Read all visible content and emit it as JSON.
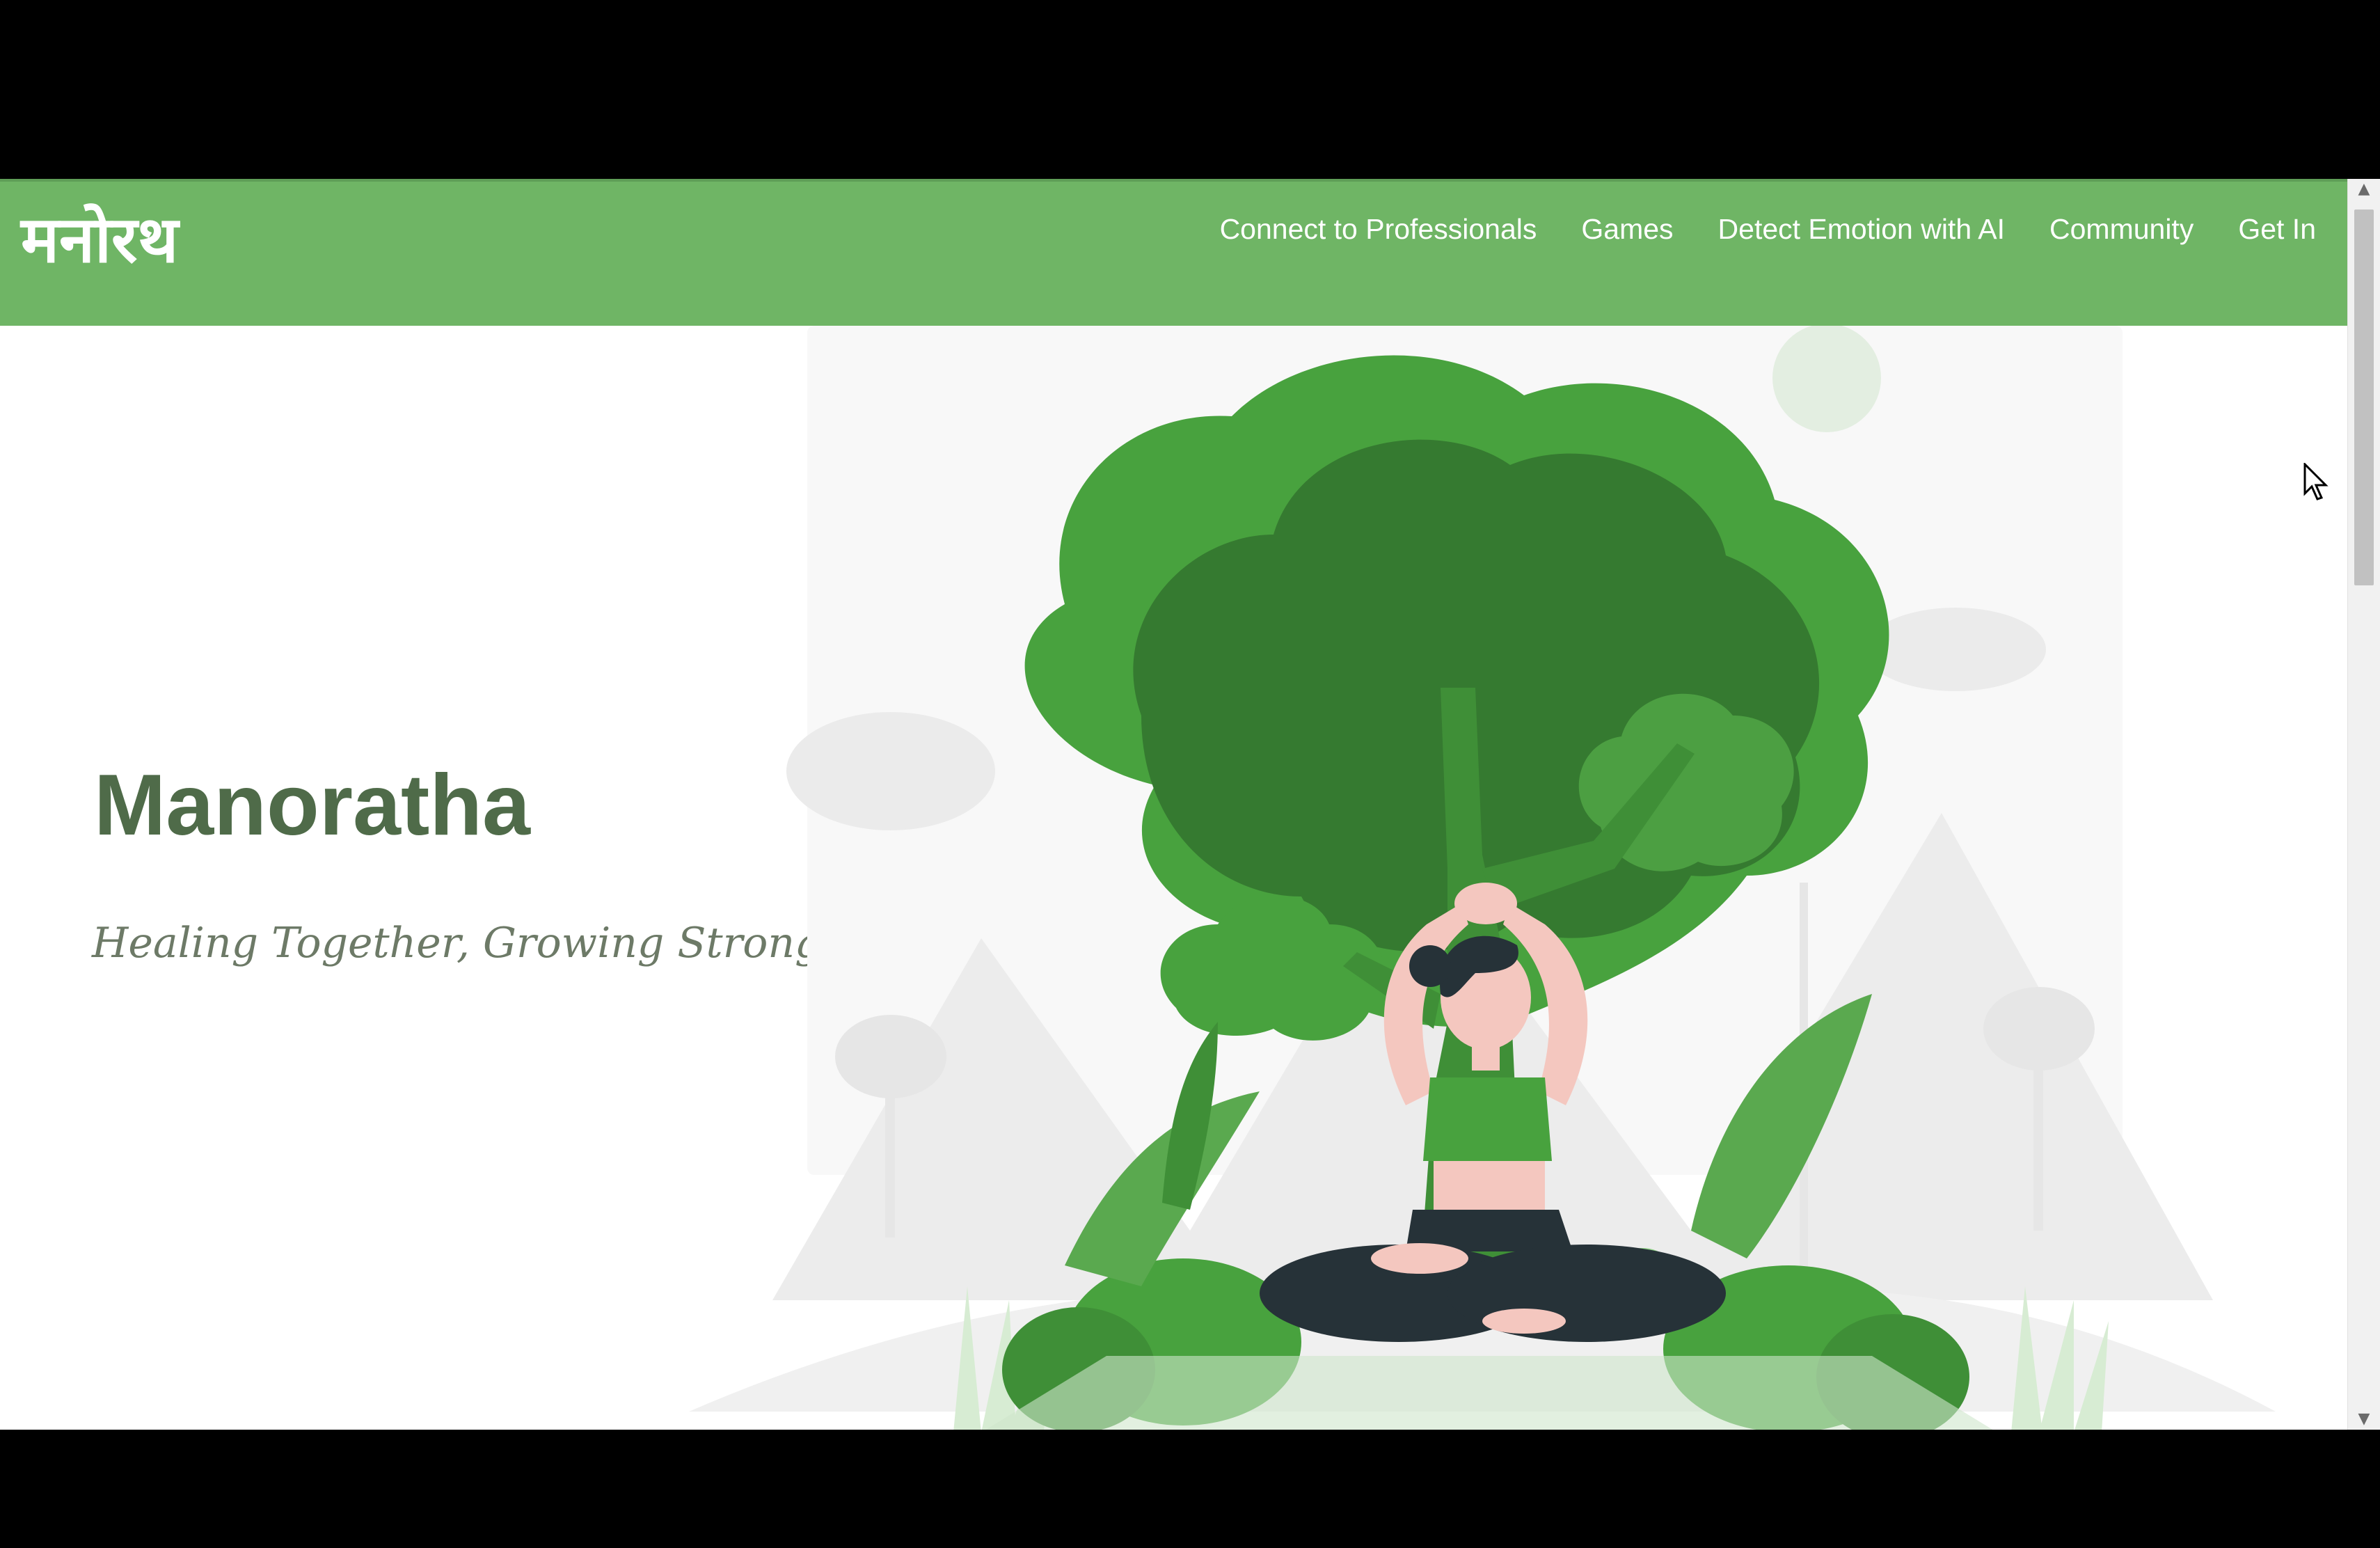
{
  "nav": {
    "brand": "मनोरथ",
    "links": [
      {
        "label": "Connect to Professionals"
      },
      {
        "label": "Games"
      },
      {
        "label": "Detect Emotion with AI"
      },
      {
        "label": "Community"
      },
      {
        "label": "Get In"
      }
    ]
  },
  "hero": {
    "title": "Manoratha",
    "tagline": "Healing Together, Growing Stronger"
  },
  "scrollbar": {
    "up_arrow_icon": "triangle-up",
    "down_arrow_icon": "triangle-down"
  },
  "illustration": {
    "icon": "yoga-woman-under-tree-illustration"
  },
  "colors": {
    "navbar": "#6fb565",
    "title": "#4f6b49",
    "tree_dark": "#357a30",
    "tree_mid": "#48a23e",
    "tree_light": "#5aa94f"
  }
}
